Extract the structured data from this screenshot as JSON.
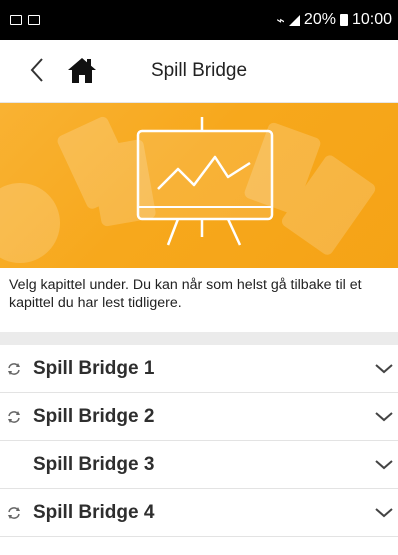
{
  "status_bar": {
    "battery": "20%",
    "time": "10:00",
    "icons": [
      "image-notification-icon",
      "mail-notification-icon",
      "wifi-icon",
      "signal-icon",
      "battery-icon"
    ]
  },
  "header": {
    "title": "Spill Bridge",
    "back_icon": "chevron-left-icon",
    "home_icon": "home-icon"
  },
  "banner": {
    "icon": "presentation-chart-icon",
    "color": "#f7a81c"
  },
  "intro_text": "Velg kapittel under. Du kan når som helst gå tilbake til et kapittel du har lest tidligere.",
  "chapters": [
    {
      "label": "Spill Bridge 1",
      "sync_icon": true
    },
    {
      "label": "Spill Bridge 2",
      "sync_icon": true
    },
    {
      "label": "Spill Bridge 3",
      "sync_icon": false
    },
    {
      "label": "Spill Bridge 4",
      "sync_icon": true
    }
  ]
}
